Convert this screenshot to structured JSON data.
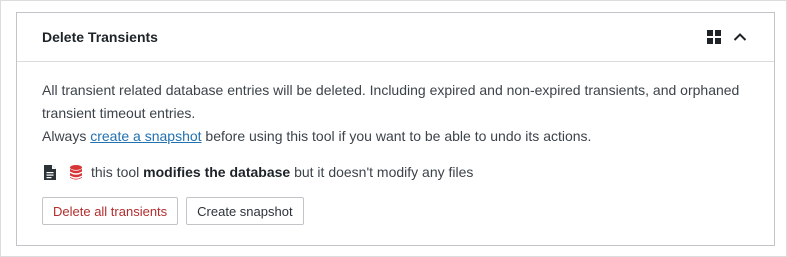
{
  "panel": {
    "title": "Delete Transients",
    "header_icons": [
      "grid-icon",
      "chevron-up-icon"
    ]
  },
  "body": {
    "description_line1": "All transient related database entries will be deleted. Including expired and non-expired transients, and orphaned transient timeout entries.",
    "description_prefix": "Always ",
    "snapshot_link": "create a snapshot",
    "description_suffix": " before using this tool if you want to be able to undo its actions.",
    "impact_prefix": "this tool ",
    "impact_bold": "modifies the database",
    "impact_suffix": " but it doesn't modify any files",
    "impact_icons": [
      "file-icon",
      "database-icon"
    ]
  },
  "buttons": {
    "delete_label": "Delete all transients",
    "snapshot_label": "Create snapshot"
  },
  "colors": {
    "danger": "#b32d2e",
    "link": "#2271b1",
    "db_icon": "#d63638"
  }
}
